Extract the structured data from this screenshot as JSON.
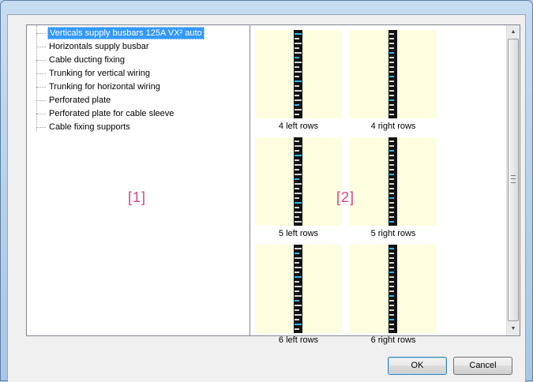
{
  "tree": {
    "items": [
      {
        "label": "Verticals supply busbars 125A VX² auto",
        "selected": true
      },
      {
        "label": "Horizontals supply busbar",
        "selected": false
      },
      {
        "label": "Cable ducting fixing",
        "selected": false
      },
      {
        "label": "Trunking for vertical wiring",
        "selected": false
      },
      {
        "label": "Trunking for horizontal wiring",
        "selected": false
      },
      {
        "label": "Perforated plate",
        "selected": false
      },
      {
        "label": "Perforated plate for cable sleeve",
        "selected": false
      },
      {
        "label": "Cable fixing supports",
        "selected": false
      }
    ],
    "marker": "[1]"
  },
  "gallery": {
    "marker": "[2]",
    "thumbnails": [
      {
        "label": "4 left rows"
      },
      {
        "label": "4 right rows"
      },
      {
        "label": "5 left rows"
      },
      {
        "label": "5 right rows"
      },
      {
        "label": "6 left rows"
      },
      {
        "label": "6 right rows"
      }
    ],
    "thumb_background": "#fdfde0"
  },
  "buttons": {
    "ok": "OK",
    "cancel": "Cancel"
  },
  "colors": {
    "selection": "#3399ff",
    "marker": "#d6448c",
    "window_frame": "#bcd3ea"
  }
}
